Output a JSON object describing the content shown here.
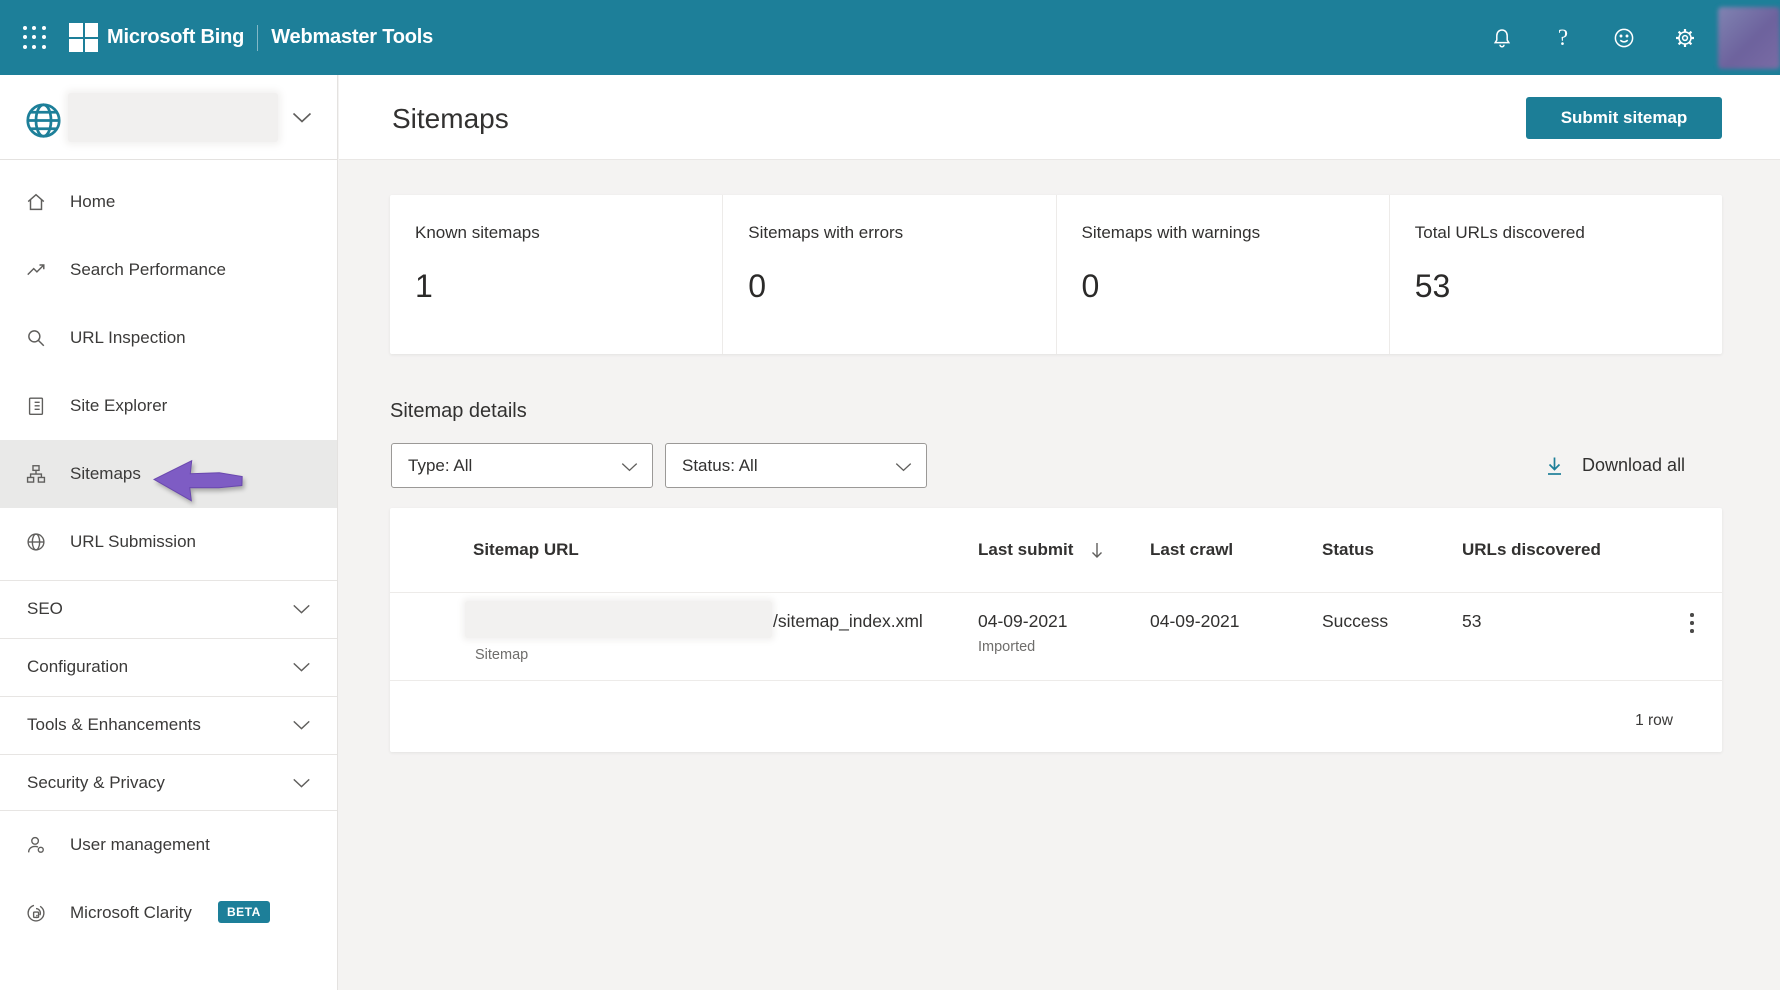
{
  "header": {
    "brand": "Microsoft Bing",
    "product": "Webmaster Tools"
  },
  "sidebar": {
    "items": [
      {
        "label": "Home"
      },
      {
        "label": "Search Performance"
      },
      {
        "label": "URL Inspection"
      },
      {
        "label": "Site Explorer"
      },
      {
        "label": "Sitemaps"
      },
      {
        "label": "URL Submission"
      }
    ],
    "sections": [
      {
        "label": "SEO"
      },
      {
        "label": "Configuration"
      },
      {
        "label": "Tools & Enhancements"
      },
      {
        "label": "Security & Privacy"
      }
    ],
    "footer_items": [
      {
        "label": "User management"
      },
      {
        "label": "Microsoft Clarity",
        "badge": "BETA"
      }
    ]
  },
  "main": {
    "title": "Sitemaps",
    "submit_button": "Submit sitemap",
    "stats": [
      {
        "label": "Known sitemaps",
        "value": "1"
      },
      {
        "label": "Sitemaps with errors",
        "value": "0"
      },
      {
        "label": "Sitemaps with warnings",
        "value": "0"
      },
      {
        "label": "Total URLs discovered",
        "value": "53"
      }
    ],
    "details": {
      "heading": "Sitemap details",
      "type_filter": "Type: All",
      "status_filter": "Status: All",
      "download_all": "Download all"
    },
    "table": {
      "columns": {
        "url": "Sitemap URL",
        "last_submit": "Last submit",
        "last_crawl": "Last crawl",
        "status": "Status",
        "urls_discovered": "URLs discovered"
      },
      "row": {
        "url_suffix": "/sitemap_index.xml",
        "type": "Sitemap",
        "last_submit": "04-09-2021",
        "submit_note": "Imported",
        "last_crawl": "04-09-2021",
        "status": "Success",
        "urls_discovered": "53"
      },
      "footer": "1 row"
    }
  },
  "colors": {
    "teal": "#1d7f99",
    "sidebar_selected": "#e9e9e8",
    "arrow_purple": "#7e5cc4"
  }
}
